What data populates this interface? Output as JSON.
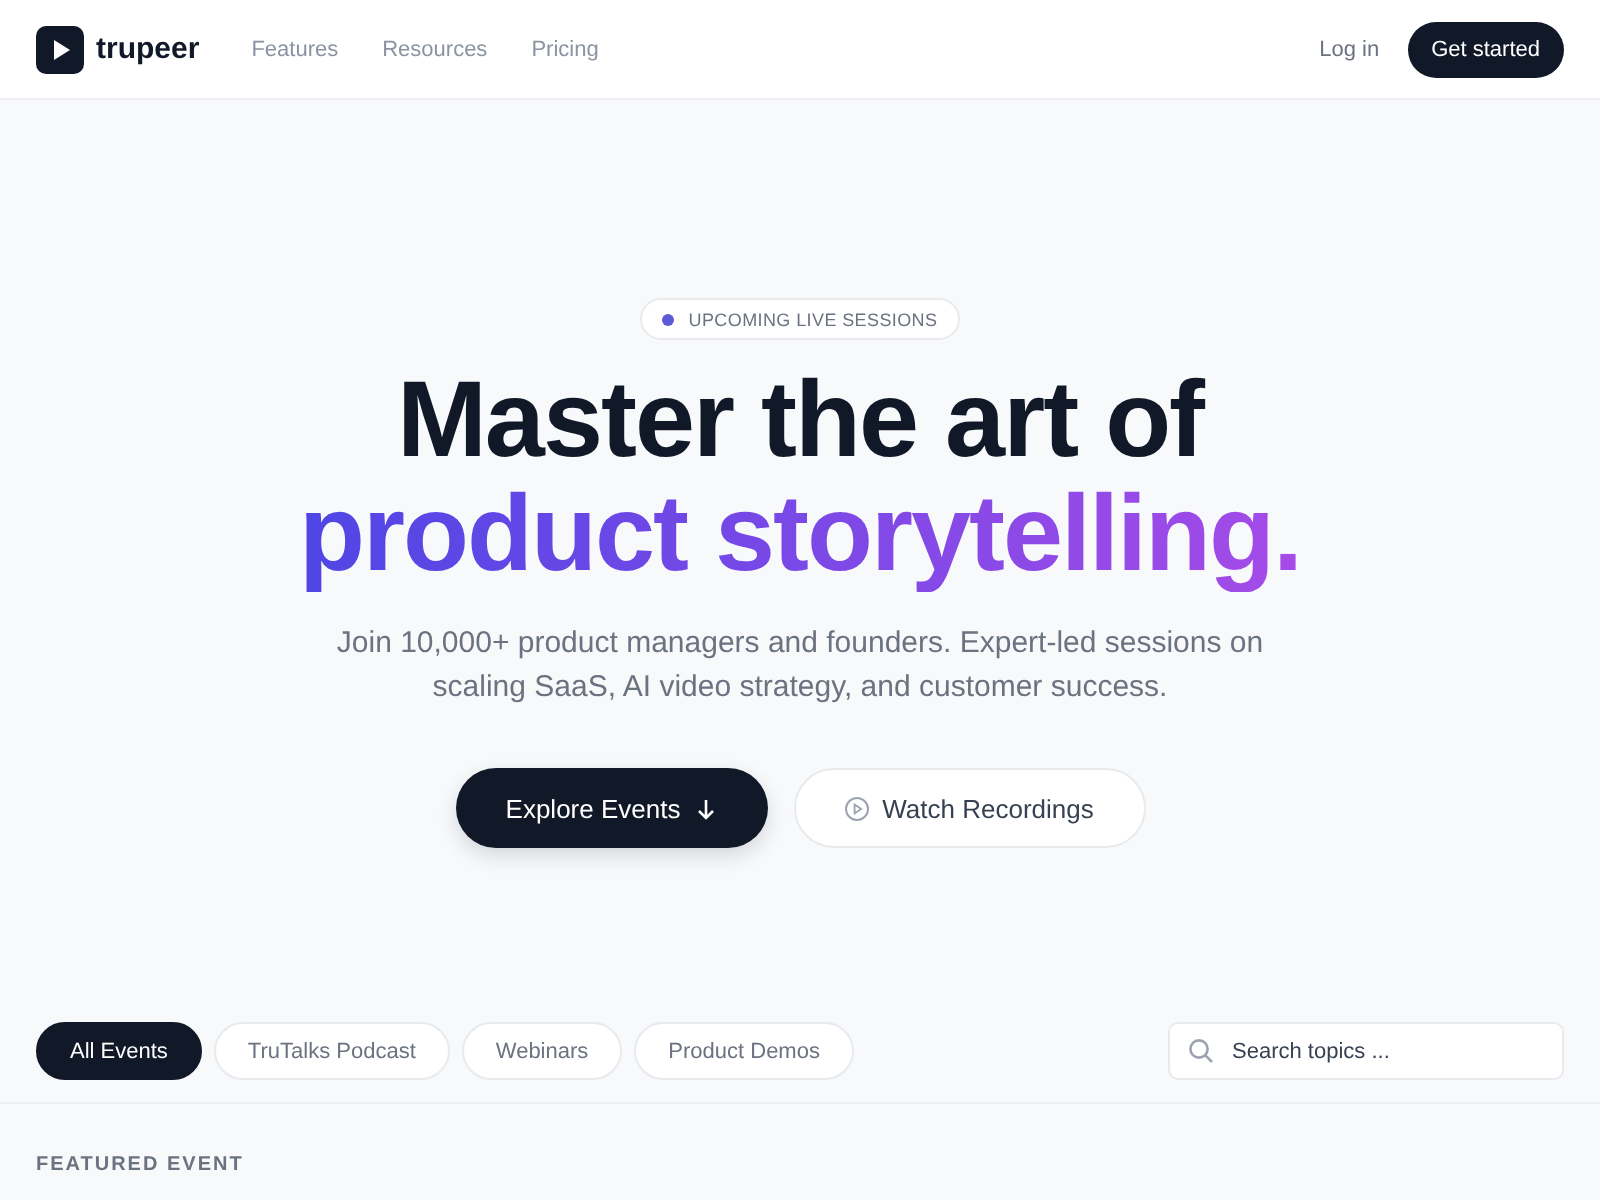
{
  "nav": {
    "logo": "trupeer",
    "links": [
      "Features",
      "Resources",
      "Pricing"
    ],
    "login": "Log in",
    "cta": "Get started"
  },
  "hero": {
    "badge": "UPCOMING LIVE SESSIONS",
    "title_line_1": "Master the art of",
    "title_line_2": "product storytelling.",
    "subtitle": "Join 10,000+ product managers and founders. Expert-led sessions on scaling SaaS, AI video strategy, and customer success.",
    "primary_button": "Explore Events",
    "secondary_button": "Watch Recordings"
  },
  "filters": [
    {
      "label": "All Events",
      "selected": true
    },
    {
      "label": "TruTalks Podcast",
      "selected": false
    },
    {
      "label": "Webinars",
      "selected": false
    },
    {
      "label": "Product Demos",
      "selected": false
    }
  ],
  "search": {
    "placeholder": "Search topics ..."
  },
  "section_label": "FEATURED EVENT"
}
